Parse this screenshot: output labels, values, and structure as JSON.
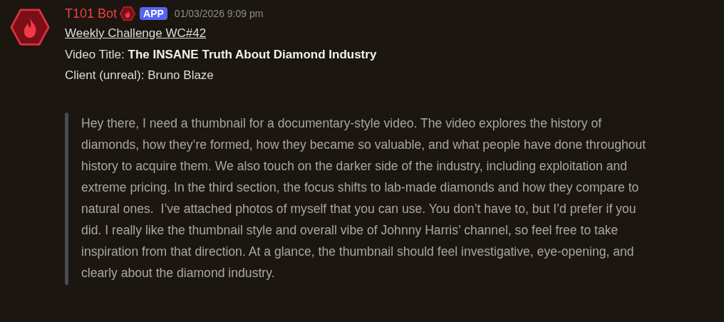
{
  "message": {
    "author": "T101 Bot",
    "app_tag": "APP",
    "timestamp": "01/03/2026 9:09 pm",
    "link": "Weekly Challenge WC#42",
    "lines": [
      "Video Title: **The INSANE Truth About Diamond Industry**",
      "Client (unreal): Bruno Blaze"
    ],
    "quote": "Hey there, I need a thumbnail for a documentary-style video. The video explores the history of diamonds, how they’re formed, how they became so valuable, and what people have done throughout history to acquire them. We also touch on the darker side of the industry, including exploitation and extreme pricing. In the third section, the focus shifts to lab-made diamonds and how they compare to natural ones.  I’ve attached photos of myself that you can use. You don’t have to, but I’d prefer if you did. I really like the thumbnail style and overall vibe of Johnny Harris’ channel, so feel free to take inspiration from that direction. At a glance, the thumbnail should feel investigative, eye-opening, and clearly about the diamond industry."
  }
}
